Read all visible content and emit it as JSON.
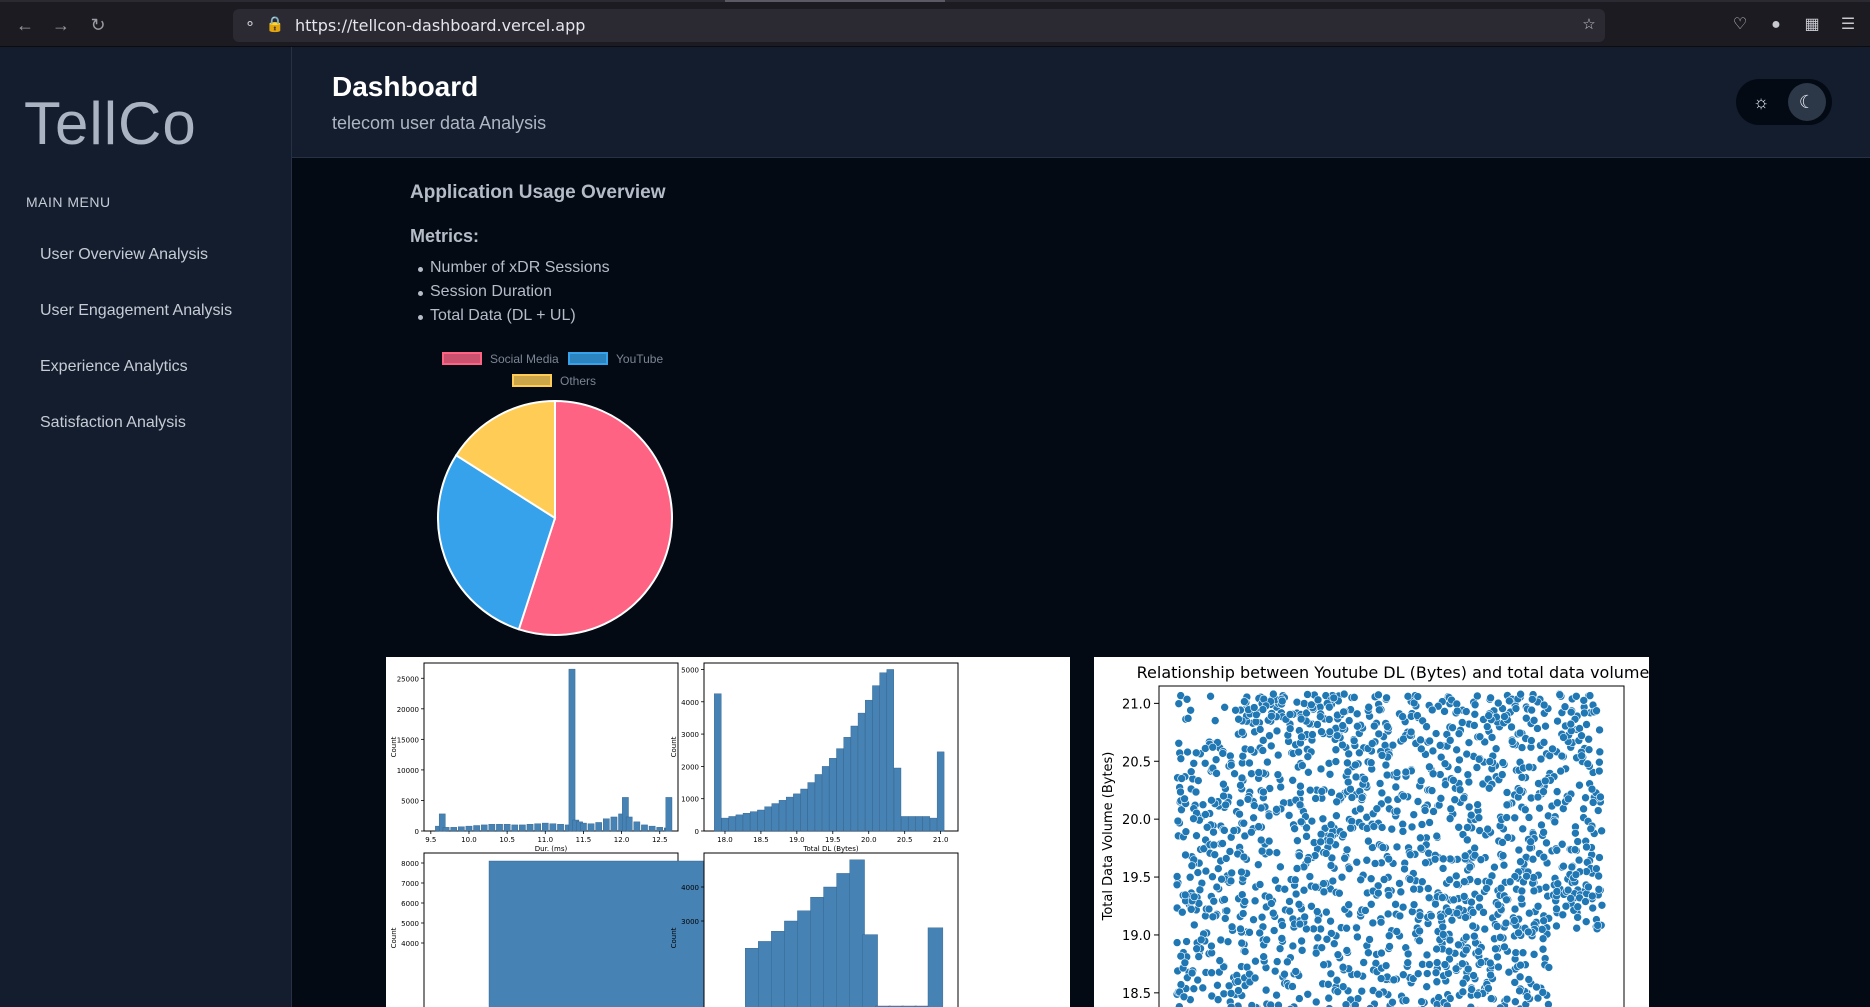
{
  "browser": {
    "url": "https://tellcon-dashboard.vercel.app",
    "icons": [
      "back-icon",
      "forward-icon",
      "reload-icon",
      "shield-icon",
      "lock-icon",
      "star-icon",
      "pocket-icon",
      "account-icon",
      "extensions-icon",
      "menu-icon"
    ]
  },
  "sidebar": {
    "logo": "TellCo",
    "menu_heading": "MAIN MENU",
    "items": [
      {
        "label": "User Overview Analysis"
      },
      {
        "label": "User Engagement Analysis"
      },
      {
        "label": "Experience Analytics"
      },
      {
        "label": "Satisfaction Analysis"
      }
    ]
  },
  "header": {
    "title": "Dashboard",
    "subtitle": "telecom user data Analysis",
    "theme_options": [
      "sun-icon",
      "moon-icon"
    ],
    "active_theme": "dark"
  },
  "main": {
    "section_title": "Application Usage Overview",
    "metrics_title": "Metrics:",
    "metrics": [
      "Number of xDR Sessions",
      "Session Duration",
      "Total Data (DL + UL)"
    ]
  },
  "colors": {
    "social_media": "#ff6384",
    "youtube": "#36a2eb",
    "others": "#ffcd56",
    "scatter": "#1f77b4",
    "bars": "#4682b4"
  },
  "chart_data": [
    {
      "type": "pie",
      "categories": [
        "Social Media",
        "YouTube",
        "Others"
      ],
      "values": [
        55,
        29,
        16
      ],
      "legend": "top"
    },
    {
      "type": "bar",
      "xlabel": "Dur. (ms)",
      "ylabel": "Count",
      "xticks": [
        "9.5",
        "10.0",
        "10.5",
        "11.0",
        "11.5",
        "12.0",
        "12.5"
      ],
      "yticks": [
        "0",
        "5000",
        "10000",
        "15000",
        "20000",
        "25000"
      ],
      "xlim": [
        9.45,
        12.7
      ],
      "ylim": [
        0,
        27500
      ],
      "x": [
        9.6,
        9.65,
        9.7,
        9.8,
        9.9,
        10.0,
        10.1,
        10.2,
        10.3,
        10.4,
        10.5,
        10.6,
        10.7,
        10.8,
        10.9,
        11.0,
        11.1,
        11.2,
        11.3,
        11.35,
        11.4,
        11.45,
        11.5,
        11.6,
        11.7,
        11.8,
        11.9,
        12.0,
        12.05,
        12.1,
        12.2,
        12.3,
        12.4,
        12.5,
        12.6,
        12.62
      ],
      "values": [
        800,
        2800,
        600,
        600,
        700,
        800,
        900,
        1000,
        1100,
        1100,
        1100,
        1000,
        1000,
        1100,
        1200,
        1300,
        1200,
        1100,
        1000,
        26500,
        1800,
        1500,
        1300,
        1200,
        1400,
        2000,
        2300,
        2800,
        5500,
        2300,
        1500,
        1000,
        800,
        600,
        500,
        5500
      ]
    },
    {
      "type": "bar",
      "xlabel": "Total DL (Bytes)",
      "ylabel": "Count",
      "xticks": [
        "18.0",
        "18.5",
        "19.0",
        "19.5",
        "20.0",
        "20.5",
        "21.0"
      ],
      "yticks": [
        "0",
        "1000",
        "2000",
        "3000",
        "4000",
        "5000"
      ],
      "xlim": [
        17.75,
        21.2
      ],
      "ylim": [
        0,
        5200
      ],
      "x": [
        17.9,
        18.0,
        18.1,
        18.2,
        18.3,
        18.4,
        18.5,
        18.6,
        18.7,
        18.8,
        18.9,
        19.0,
        19.1,
        19.2,
        19.3,
        19.4,
        19.5,
        19.6,
        19.7,
        19.8,
        19.9,
        20.0,
        20.1,
        20.2,
        20.3,
        20.4,
        20.5,
        20.6,
        20.7,
        20.8,
        20.9,
        21.0
      ],
      "values": [
        4250,
        400,
        450,
        500,
        550,
        600,
        650,
        750,
        850,
        950,
        1050,
        1150,
        1300,
        1500,
        1750,
        2000,
        2250,
        2550,
        2900,
        3250,
        3650,
        4050,
        4500,
        4900,
        5000,
        1950,
        450,
        450,
        450,
        450,
        400,
        2450
      ]
    },
    {
      "type": "bar",
      "ylabel": "Count",
      "yticks": [
        "4000",
        "5000",
        "6000",
        "7000",
        "8000"
      ],
      "ylim": [
        0,
        8500
      ],
      "x": [
        12.6
      ],
      "values": [
        8100
      ]
    },
    {
      "type": "bar",
      "ylabel": "Count",
      "yticks": [
        "3000",
        "4000"
      ],
      "ylim": [
        0,
        5000
      ],
      "x": [
        19.6,
        19.7,
        19.8,
        19.9,
        20.0,
        20.1,
        20.2,
        20.3,
        20.4,
        20.5,
        20.6,
        20.7,
        20.8,
        20.9,
        21.0
      ],
      "values": [
        2200,
        2400,
        2700,
        3000,
        3300,
        3700,
        4000,
        4400,
        4800,
        2600,
        500,
        500,
        500,
        500,
        2800
      ]
    },
    {
      "type": "scatter",
      "title": "Relationship between Youtube DL (Bytes) and total data volume",
      "ylabel": "Total Data Volume (Bytes)",
      "yticks": [
        "18.5",
        "19.0",
        "19.5",
        "20.0",
        "20.5",
        "21.0"
      ],
      "ylim": [
        18.3,
        21.15
      ]
    }
  ]
}
